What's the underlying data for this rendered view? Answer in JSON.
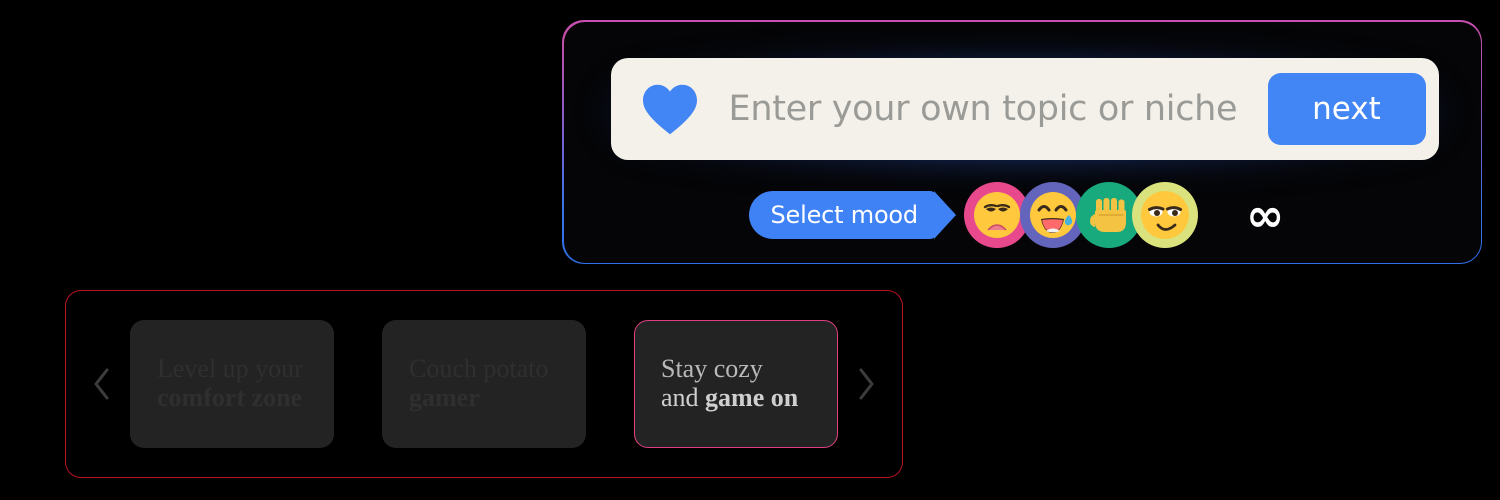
{
  "search": {
    "icon": "blue-heart-icon",
    "placeholder": "Enter your own topic or niche",
    "value": "",
    "next_label": "next"
  },
  "mood": {
    "tag_label": "Select mood",
    "infinity_symbol": "∞",
    "options": [
      {
        "name": "disappointed-face-emoji",
        "ring_color": "#e8498d",
        "face_color": "#ffc83d",
        "label": "disappointed"
      },
      {
        "name": "laughing-tear-emoji",
        "ring_color": "#6365bd",
        "face_color": "#ffc83d",
        "label": "laughing with tear"
      },
      {
        "name": "raised-fist-emoji",
        "ring_color": "#18a97c",
        "face_color": "#f5c344",
        "label": "raised fist"
      },
      {
        "name": "smirking-face-emoji",
        "ring_color": "#d9e27c",
        "face_color": "#ffc83d",
        "label": "smirking"
      }
    ]
  },
  "carousel": {
    "prev_label": "‹",
    "next_label": "›",
    "cards": [
      {
        "line1": "Level up your",
        "line2_bold": "comfort zone",
        "active": false
      },
      {
        "line1": "Couch potato",
        "line2_bold": "gamer",
        "active": false
      },
      {
        "line1": "Stay cozy",
        "line2_prefix": "and ",
        "line2_bold": "game on",
        "active": true
      }
    ]
  },
  "colors": {
    "accent_blue": "#4285f4",
    "panel_border_top": "#c850b4",
    "panel_border_bottom": "#2f6fe8",
    "carousel_border": "#b8121f",
    "active_card_border": "#e0407f",
    "input_bg": "#f4f1ea",
    "page_bg": "#000000"
  }
}
